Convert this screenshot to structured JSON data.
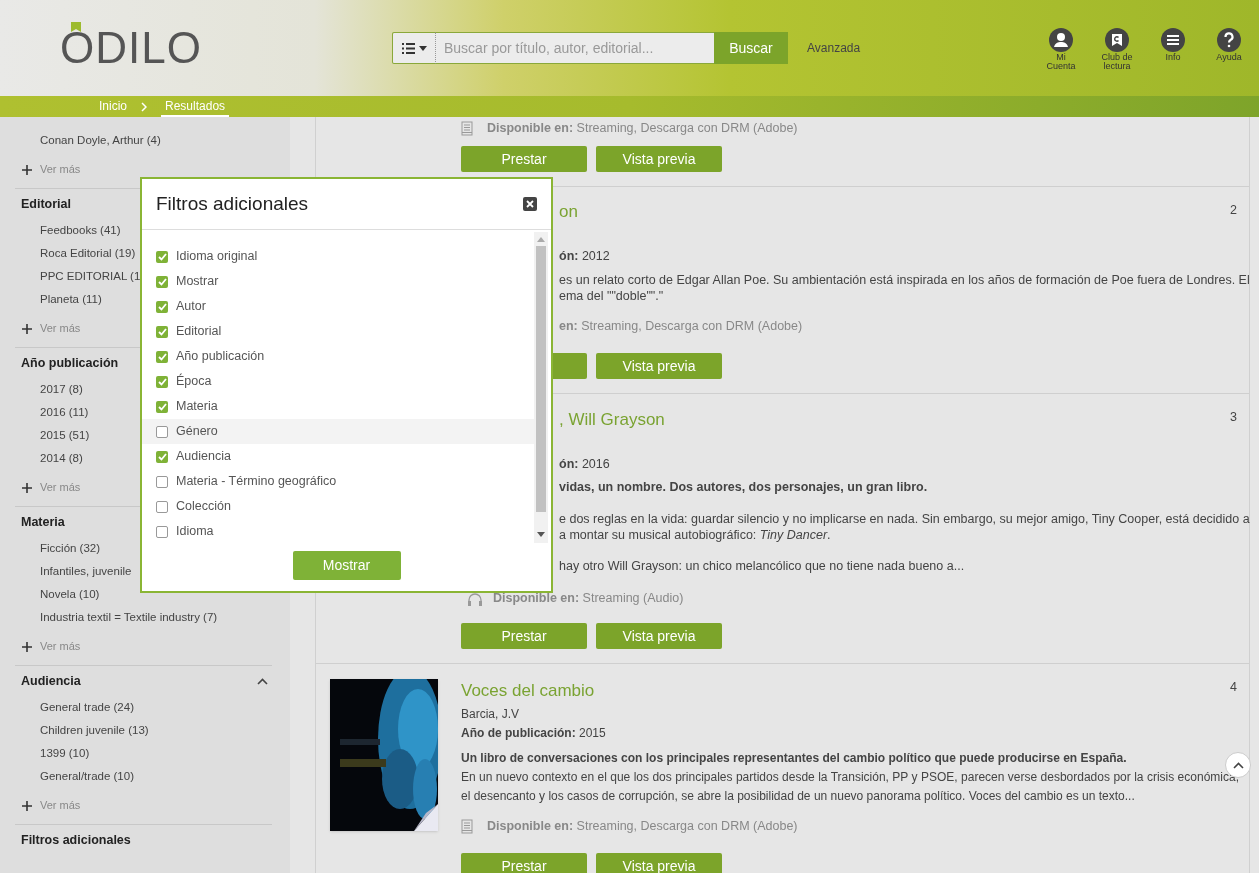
{
  "header": {
    "logo": "ODILO",
    "search": {
      "placeholder": "Buscar por título, autor, editorial...",
      "button": "Buscar"
    },
    "advanced_link": "Avanzada",
    "nav": [
      {
        "label": "Mi Cuenta",
        "kind": "account"
      },
      {
        "label": "Club de lectura",
        "kind": "club"
      },
      {
        "label": "Info",
        "kind": "info"
      },
      {
        "label": "Ayuda",
        "kind": "help"
      }
    ]
  },
  "breadcrumb": [
    {
      "label": "Inicio",
      "selected": false
    },
    {
      "label": "Resultados",
      "selected": true
    }
  ],
  "sidebar": {
    "sections": [
      {
        "items": [
          "Conan Doyle, Arthur (4)"
        ],
        "more": "Ver más"
      },
      {
        "title": "Editorial",
        "items": [
          "Feedbooks (41)",
          "Roca Editorial (19)",
          "PPC EDITORIAL (1",
          "Planeta (11)"
        ],
        "more": "Ver más"
      },
      {
        "title": "Año publicación",
        "items": [
          "2017 (8)",
          "2016 (11)",
          "2015 (51)",
          "2014 (8)"
        ],
        "more": "Ver más"
      },
      {
        "title": "Materia",
        "items": [
          "Ficción (32)",
          "Infantiles, juvenile",
          "Novela (10)",
          "Industria textil = Textile industry (7)"
        ],
        "more": "Ver más"
      },
      {
        "title": "Audiencia",
        "expanded": true,
        "items": [
          "General trade (24)",
          "Children juvenile (13)",
          "1399 (10)",
          "General/trade (10)"
        ],
        "more": "Ver más"
      },
      {
        "title": "Filtros adicionales"
      }
    ]
  },
  "results": [
    {
      "kind": "tail",
      "availability": {
        "kind": "ebook",
        "text": "**Disponible en:** Streaming, Descarga con DRM (Adobe)"
      },
      "buttons": [
        "Prestar",
        "Vista previa"
      ]
    },
    {
      "kind": "covered",
      "number": "2",
      "title": "on",
      "year": "**ón:** 2012",
      "description": [
        {
          "lines": [
            "es un relato corto de Edgar Allan Poe. Su ambientación está inspirada en los años de formación de Poe fuera de Londres. El",
            "ema del \"\"doble\"\".\""
          ]
        }
      ],
      "availability": {
        "text": "**en:** Streaming, Descarga con DRM (Adobe)"
      },
      "buttons": [
        "Vista previa"
      ]
    },
    {
      "kind": "covered",
      "number": "3",
      "title": ", Will Grayson",
      "year": "**ón:** 2016",
      "summary": "vidas, un nombre. Dos autores, dos personajes, un gran libro.",
      "description": [
        {
          "lines": [
            "e dos reglas en la vida: guardar silencio y no implicarse en nada. Sin embargo, su mejor amigo, Tiny Cooper, está decidido a",
            "a montar su musical autobiográfico: *Tiny Dancer*."
          ]
        },
        {
          "lines": [
            "hay otro Will Grayson: un chico melancólico que no tiene nada bueno a..."
          ]
        }
      ],
      "availability": {
        "kind": "audio",
        "text": "**Disponible en:** Streaming (Audio)"
      },
      "buttons": [
        "Prestar",
        "Vista previa"
      ]
    },
    {
      "kind": "full",
      "number": "4",
      "title": "Voces del cambio",
      "author": "Barcia, J.V",
      "year": "**Año de publicación:** 2015",
      "summary": "Un libro de conversaciones con los principales representantes del cambio político que puede producirse en España.",
      "paragraph": "En un nuevo contexto en el que los dos principales partidos desde la Transición, PP y PSOE, parecen verse desbordados por la crisis económica, el desencanto y los casos de corrupción, se abre la posibilidad de un nuevo panorama político. Voces del cambio es un texto...",
      "availability": {
        "kind": "ebook",
        "text": "**Disponible en:** Streaming, Descarga con DRM (Adobe)"
      },
      "buttons": [
        "Prestar",
        "Vista previa"
      ]
    }
  ],
  "modal": {
    "title": "Filtros adicionales",
    "options": [
      {
        "label": "Idioma original",
        "checked": true,
        "highlighted": false
      },
      {
        "label": "Mostrar",
        "checked": true,
        "highlighted": false
      },
      {
        "label": "Autor",
        "checked": true,
        "highlighted": false
      },
      {
        "label": "Editorial",
        "checked": true,
        "highlighted": false
      },
      {
        "label": "Año publicación",
        "checked": true,
        "highlighted": false
      },
      {
        "label": "Época",
        "checked": true,
        "highlighted": false
      },
      {
        "label": "Materia",
        "checked": true,
        "highlighted": false
      },
      {
        "label": "Género",
        "checked": false,
        "highlighted": true
      },
      {
        "label": "Audiencia",
        "checked": true,
        "highlighted": false
      },
      {
        "label": "Materia - Término geográfico",
        "checked": false,
        "highlighted": false
      },
      {
        "label": "Colección",
        "checked": false,
        "highlighted": false
      },
      {
        "label": "Idioma",
        "checked": false,
        "highlighted": false
      }
    ],
    "button": "Mostrar"
  }
}
